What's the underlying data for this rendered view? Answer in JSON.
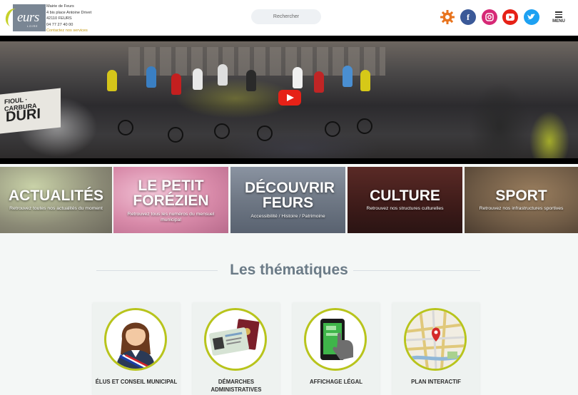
{
  "header": {
    "logo_text": "eurs",
    "logo_sub": "LOIRE",
    "contact_lines": [
      "Mairie de Feurs",
      "4 bis place Antoine Drivet",
      "42110 FEURS",
      "04 77 27 40 00"
    ],
    "contact_link": "Contactez nos services",
    "search_placeholder": "Rechercher",
    "menu_label": "MENU"
  },
  "social": [
    {
      "name": "gear-icon",
      "glyph": "✹",
      "color": "#e8741e"
    },
    {
      "name": "facebook-icon",
      "glyph": "f",
      "color": "#3b5998"
    },
    {
      "name": "instagram-icon",
      "glyph": "◎",
      "color": "#d62976"
    },
    {
      "name": "youtube-icon",
      "glyph": "▶",
      "color": "#e62117"
    },
    {
      "name": "twitter-icon",
      "glyph": "✦",
      "color": "#1da1f2"
    }
  ],
  "hero": {
    "banner_line1": "FIOUL · CARBURA",
    "banner_line2": "DURI"
  },
  "tiles": [
    {
      "title": "ACTUALITÉS",
      "sub": "Retrouvez toutes nos actualités du moment"
    },
    {
      "title": "LE PETIT FORÉZIEN",
      "sub": "Retrouvez tous les numéros du mensuel municipal"
    },
    {
      "title": "DÉCOUVRIR FEURS",
      "sub": "Accessibilité / Histoire / Patrimoine"
    },
    {
      "title": "CULTURE",
      "sub": "Retrouvez nos structures culturelles"
    },
    {
      "title": "SPORT",
      "sub": "Retrouvez nos infrastructures sportives"
    }
  ],
  "thematiques": {
    "title": "Les thématiques",
    "cards": [
      {
        "label": "ÉLUS ET CONSEIL MUNICIPAL"
      },
      {
        "label": "DÉMARCHES ADMINISTRATIVES"
      },
      {
        "label": "AFFICHAGE LÉGAL"
      },
      {
        "label": "PLAN INTERACTIF"
      }
    ]
  },
  "colors": {
    "accent": "#b8c41c",
    "contact_link": "#c49a12",
    "section_title": "#6b7b87"
  }
}
